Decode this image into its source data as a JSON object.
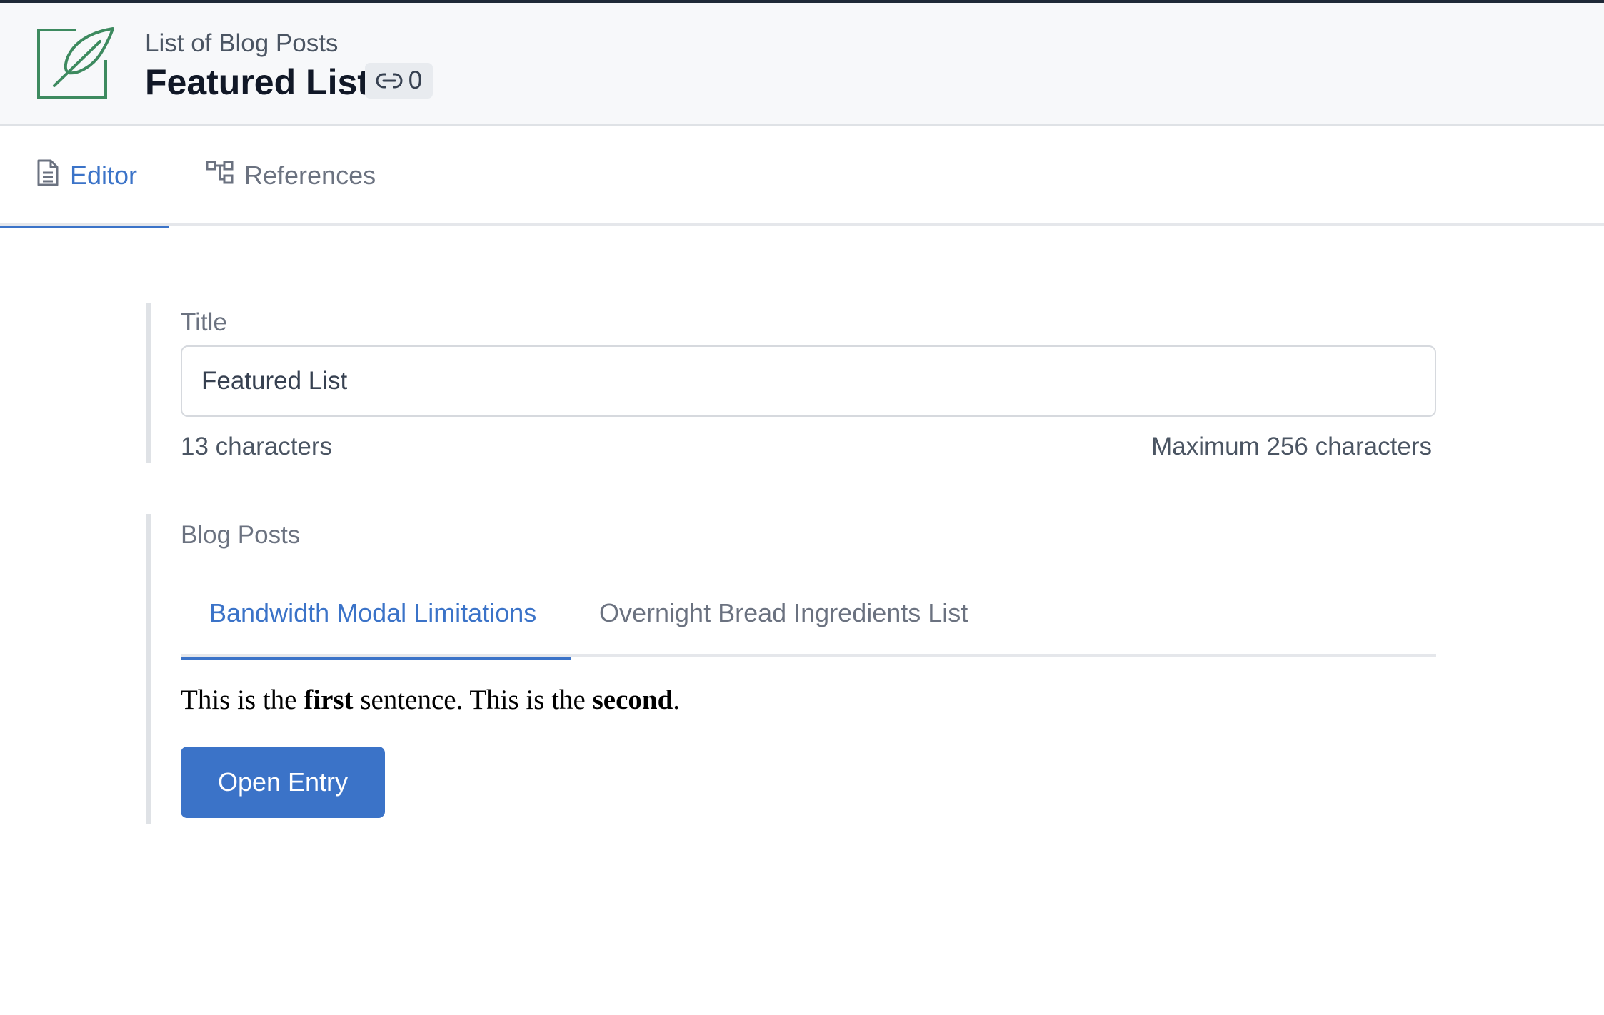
{
  "header": {
    "content_type": "List of Blog Posts",
    "title": "Featured List",
    "reference_count": "0",
    "logo_icon": "feather-icon",
    "accent_color": "#3d8a5f"
  },
  "tabs": [
    {
      "label": "Editor",
      "icon": "document-icon",
      "active": true
    },
    {
      "label": "References",
      "icon": "hierarchy-icon",
      "active": false
    }
  ],
  "title_field": {
    "label": "Title",
    "value": "Featured List",
    "char_count": "13 characters",
    "max_chars": "Maximum 256 characters"
  },
  "blog_posts_field": {
    "label": "Blog Posts",
    "tabs": [
      {
        "label": "Bandwidth Modal Limitations",
        "active": true
      },
      {
        "label": "Overnight Bread Ingredients List",
        "active": false
      }
    ],
    "preview": {
      "part1": "This is the ",
      "bold1": "first",
      "part2": " sentence. This is the ",
      "bold2": "second",
      "part3": "."
    },
    "open_button": "Open Entry"
  },
  "colors": {
    "primary": "#3b73c8",
    "header_bg": "#f7f8fa"
  }
}
